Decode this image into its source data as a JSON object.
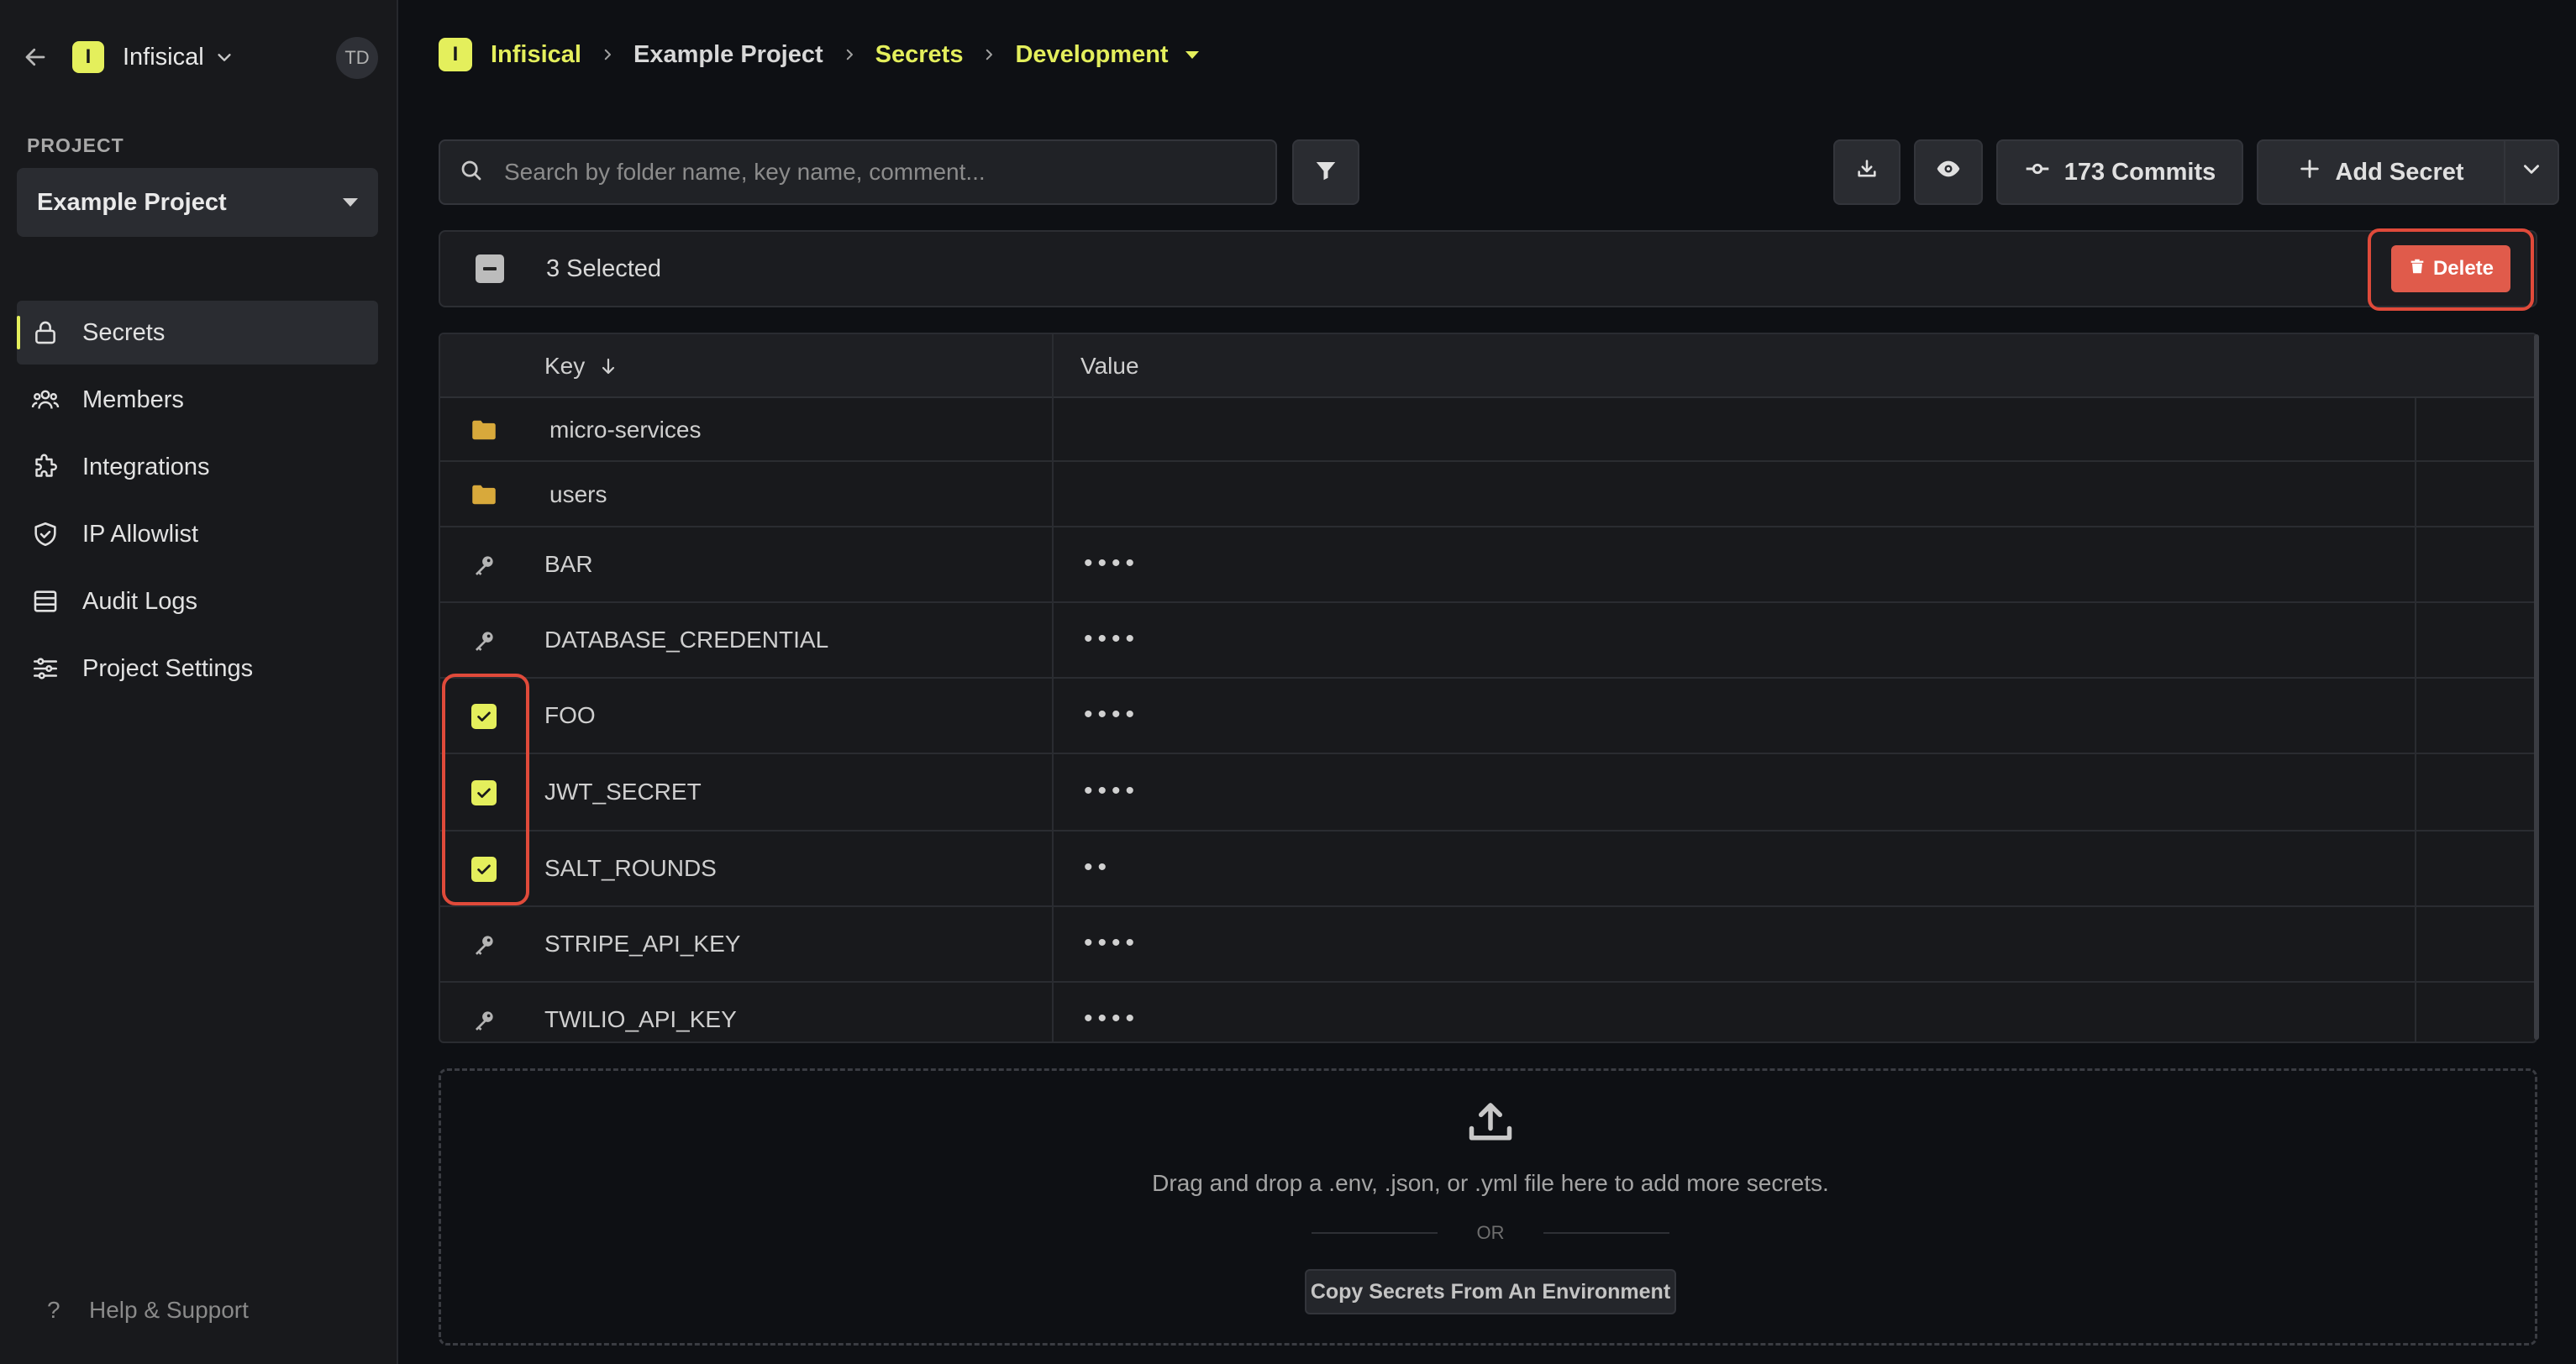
{
  "sidebar": {
    "org_logo": "I",
    "org_name": "Infisical",
    "avatar": "TD",
    "project_label": "PROJECT",
    "project_name": "Example Project",
    "items": [
      {
        "label": "Secrets",
        "icon": "lock-icon",
        "active": true
      },
      {
        "label": "Members",
        "icon": "users-icon"
      },
      {
        "label": "Integrations",
        "icon": "puzzle-icon"
      },
      {
        "label": "IP Allowlist",
        "icon": "shield-icon"
      },
      {
        "label": "Audit Logs",
        "icon": "list-icon"
      },
      {
        "label": "Project Settings",
        "icon": "sliders-icon"
      }
    ],
    "help": "Help & Support"
  },
  "breadcrumb": {
    "logo": "I",
    "org": "Infisical",
    "project": "Example Project",
    "section": "Secrets",
    "environment": "Development"
  },
  "toolbar": {
    "search_placeholder": "Search by folder name, key name, comment...",
    "commits_label": "173 Commits",
    "add_label": "Add Secret"
  },
  "selection": {
    "count_label": "3 Selected",
    "delete_label": "Delete"
  },
  "table": {
    "headers": {
      "key": "Key",
      "value": "Value"
    },
    "folders": [
      "micro-services",
      "users"
    ],
    "secrets": [
      {
        "key": "BAR",
        "value": "••••",
        "selected": false
      },
      {
        "key": "DATABASE_CREDENTIAL",
        "value": "••••",
        "selected": false
      },
      {
        "key": "FOO",
        "value": "••••",
        "selected": true
      },
      {
        "key": "JWT_SECRET",
        "value": "••••",
        "selected": true
      },
      {
        "key": "SALT_ROUNDS",
        "value": "••",
        "selected": true
      },
      {
        "key": "STRIPE_API_KEY",
        "value": "••••",
        "selected": false
      },
      {
        "key": "TWILIO_API_KEY",
        "value": "••••",
        "selected": false
      }
    ]
  },
  "dropzone": {
    "text": "Drag and drop a .env, .json, or .yml file here to add more secrets.",
    "or": "OR",
    "copy_label": "Copy Secrets From An Environment"
  },
  "colors": {
    "accent": "#e4ef5c",
    "danger": "#e05b4b",
    "background": "#0e1014"
  }
}
